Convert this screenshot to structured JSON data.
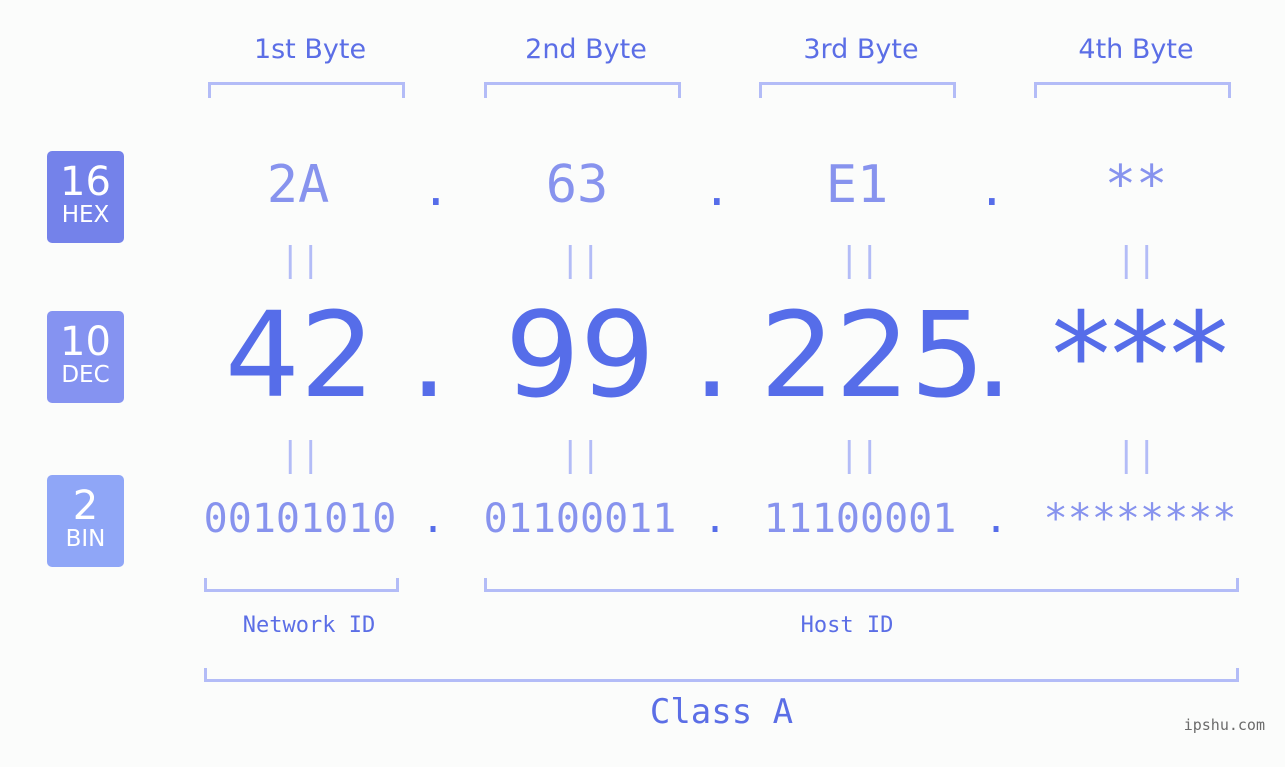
{
  "byte_headers": [
    "1st Byte",
    "2nd Byte",
    "3rd Byte",
    "4th Byte"
  ],
  "badges": {
    "hex": {
      "num": "16",
      "label": "HEX",
      "color": "#7482ea"
    },
    "dec": {
      "num": "10",
      "label": "DEC",
      "color": "#8593f1"
    },
    "bin": {
      "num": "2",
      "label": "BIN",
      "color": "#8fa6f7"
    }
  },
  "hex": [
    "2A",
    "63",
    "E1",
    "**"
  ],
  "dec": [
    "42",
    "99",
    "225",
    "***"
  ],
  "bin": [
    "00101010",
    "01100011",
    "11100001",
    "********"
  ],
  "separator": ".",
  "equals": "||",
  "network_id_label": "Network ID",
  "host_id_label": "Host ID",
  "class_label": "Class A",
  "watermark": "ipshu.com",
  "colors": {
    "accent": "#566de9",
    "light": "#b3bcf7",
    "mid": "#8793ee"
  }
}
